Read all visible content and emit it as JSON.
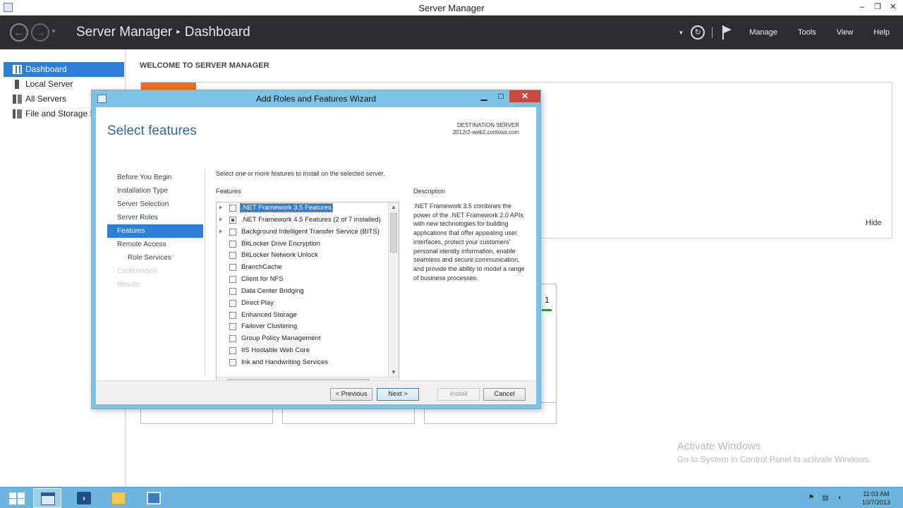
{
  "window": {
    "title": "Server Manager"
  },
  "header": {
    "breadcrumb_root": "Server Manager",
    "breadcrumb_sep": "▸",
    "breadcrumb_page": "Dashboard",
    "menus": [
      "Manage",
      "Tools",
      "View",
      "Help"
    ]
  },
  "sidebar": {
    "items": [
      {
        "label": "Dashboard",
        "icon": "dashboard-icon",
        "active": true
      },
      {
        "label": "Local Server",
        "icon": "server-icon"
      },
      {
        "label": "All Servers",
        "icon": "servers-icon"
      },
      {
        "label": "File and Storage Services",
        "icon": "storage-icon"
      }
    ]
  },
  "main": {
    "welcome_heading": "WELCOME TO SERVER MANAGER",
    "hide_label": "Hide",
    "tile_count": "1"
  },
  "wizard": {
    "title": "Add Roles and Features Wizard",
    "page_heading": "Select features",
    "destination_label": "DESTINATION SERVER",
    "destination_server": "2012r2-web2.contoso.com",
    "steps": [
      {
        "label": "Before You Begin",
        "state": "normal"
      },
      {
        "label": "Installation Type",
        "state": "normal"
      },
      {
        "label": "Server Selection",
        "state": "normal"
      },
      {
        "label": "Server Roles",
        "state": "normal"
      },
      {
        "label": "Features",
        "state": "active"
      },
      {
        "label": "Remote Access",
        "state": "normal"
      },
      {
        "label": "Role Services",
        "state": "sub"
      },
      {
        "label": "Confirmation",
        "state": "disabled"
      },
      {
        "label": "Results",
        "state": "disabled"
      }
    ],
    "instruction": "Select one or more features to install on the selected server.",
    "features_label": "Features",
    "description_label": "Description",
    "description_text": ".NET Framework 3.5 combines the power of the .NET Framework 2.0 APIs with new technologies for building applications that offer appealing user interfaces, protect your customers' personal identity information, enable seamless and secure communication, and provide the ability to model a range of business processes.",
    "features": [
      {
        "label": ".NET Framework 3.5 Features",
        "expandable": true,
        "checked": "none",
        "selected": true
      },
      {
        "label": ".NET Framework 4.5 Features (2 of 7 installed)",
        "expandable": true,
        "checked": "partial",
        "selected": false
      },
      {
        "label": "Background Intelligent Transfer Service (BITS)",
        "expandable": true,
        "checked": "none",
        "selected": false
      },
      {
        "label": "BitLocker Drive Encryption",
        "expandable": false,
        "checked": "none",
        "selected": false
      },
      {
        "label": "BitLocker Network Unlock",
        "expandable": false,
        "checked": "none",
        "selected": false
      },
      {
        "label": "BranchCache",
        "expandable": false,
        "checked": "none",
        "selected": false
      },
      {
        "label": "Client for NFS",
        "expandable": false,
        "checked": "none",
        "selected": false
      },
      {
        "label": "Data Center Bridging",
        "expandable": false,
        "checked": "none",
        "selected": false
      },
      {
        "label": "Direct Play",
        "expandable": false,
        "checked": "none",
        "selected": false
      },
      {
        "label": "Enhanced Storage",
        "expandable": false,
        "checked": "none",
        "selected": false
      },
      {
        "label": "Failover Clustering",
        "expandable": false,
        "checked": "none",
        "selected": false
      },
      {
        "label": "Group Policy Management",
        "expandable": false,
        "checked": "none",
        "selected": false
      },
      {
        "label": "IIS Hostable Web Core",
        "expandable": false,
        "checked": "none",
        "selected": false
      },
      {
        "label": "Ink and Handwriting Services",
        "expandable": false,
        "checked": "none",
        "selected": false
      }
    ],
    "buttons": {
      "previous": "< Previous",
      "next": "Next >",
      "install": "Install",
      "cancel": "Cancel"
    }
  },
  "watermark": {
    "line1": "Activate Windows",
    "line2": "Go to System in Control Panel to activate Windows."
  },
  "taskbar": {
    "time": "11:03 AM",
    "date": "10/7/2013"
  },
  "colors": {
    "accent": "#2f7ed8",
    "header_bg": "#2d2d30",
    "dialog_frame": "#7cc4e6",
    "welcome_accent": "#f36d20",
    "taskbar": "#6bb5de"
  }
}
